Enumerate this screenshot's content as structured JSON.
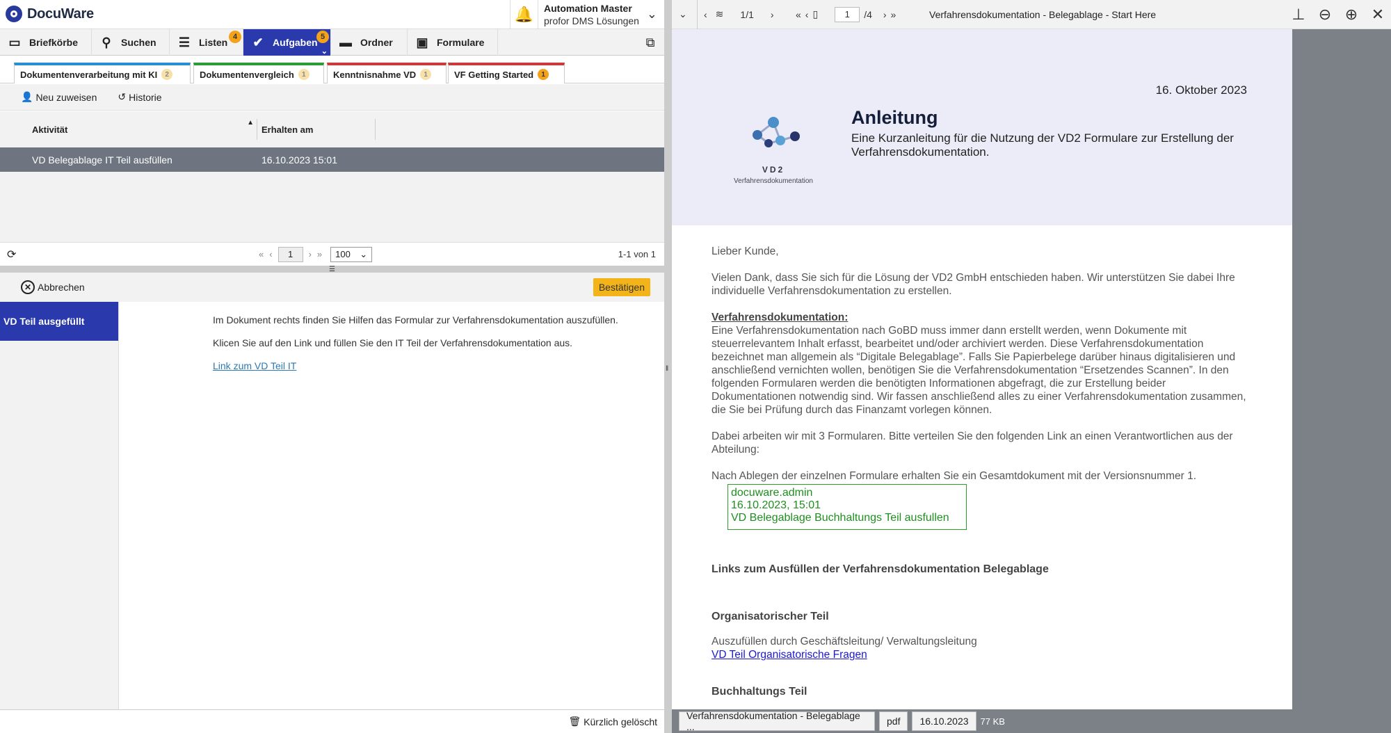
{
  "app": {
    "name": "DocuWare",
    "user_name": "Automation Master",
    "user_company": "profor DMS Lösungen"
  },
  "nav": {
    "items": [
      {
        "label": "Briefkörbe",
        "icon": "inbox-icon"
      },
      {
        "label": "Suchen",
        "icon": "search-icon"
      },
      {
        "label": "Listen",
        "icon": "list-icon",
        "badge": "4"
      },
      {
        "label": "Aufgaben",
        "icon": "check-icon",
        "badge": "5",
        "active": true
      },
      {
        "label": "Ordner",
        "icon": "folder-icon"
      },
      {
        "label": "Formulare",
        "icon": "clipboard-icon"
      }
    ]
  },
  "tabs": [
    {
      "label": "Dokumentenverarbeitung mit KI",
      "badge": "2",
      "color": "#2a8fd0"
    },
    {
      "label": "Dokumentenvergleich",
      "badge": "1",
      "color": "#2a9a3a"
    },
    {
      "label": "Kenntnisnahme VD",
      "badge": "1",
      "color": "#c93a3a"
    },
    {
      "label": "VF Getting Started",
      "badge": "1",
      "color": "#c93a3a"
    }
  ],
  "actions": {
    "reassign": "Neu zuweisen",
    "history": "Historie"
  },
  "grid": {
    "columns": [
      "Aktivität",
      "Erhalten am"
    ],
    "rows": [
      {
        "activity": "VD Belegablage IT Teil ausfüllen",
        "received": "16.10.2023 15:01"
      }
    ]
  },
  "pager": {
    "page": "1",
    "page_size": "100",
    "count": "1-1 von 1"
  },
  "form": {
    "cancel": "Abbrechen",
    "confirm": "Bestätigen",
    "step": "VD Teil ausgefüllt",
    "text1": "Im Dokument rechts finden Sie Hilfen das Formular zur Verfahrensdokumentation auszufüllen.",
    "text2": "Klicen Sie auf den Link und füllen Sie den IT Teil der Verfahrensdokumentation aus.",
    "link": "Link zum VD Teil IT"
  },
  "footer": {
    "recent": "Kürzlich gelöscht"
  },
  "viewer": {
    "stack_count": "1/1",
    "page": "1",
    "page_total": "/4",
    "title": "Verfahrensdokumentation - Belegablage - Start Here",
    "doc": {
      "date": "16. Oktober 2023",
      "heading": "Anleitung",
      "subheading": "Eine Kurzanleitung für die Nutzung der VD2 Formulare zur Erstellung der Verfahrensdokumentation.",
      "logo_title": "VD2",
      "logo_sub": "Verfahrensdokumentation",
      "greeting": "Lieber Kunde,",
      "p1": "Vielen Dank, dass Sie sich für die Lösung der VD2 GmbH entschieden haben. Wir unterstützen Sie dabei Ihre individuelle Verfahrensdokumentation zu erstellen.",
      "vd_heading": "Verfahrensdokumentation:",
      "p2": "Eine Verfahrensdokumentation nach GoBD muss immer dann erstellt werden, wenn Dokumente mit steuerrelevantem Inhalt erfasst, bearbeitet und/oder archiviert werden. Diese Verfahrensdokumentation bezeichnet man allgemein als “Digitale Belegablage”. Falls Sie Papierbelege darüber hinaus digitalisieren und anschließend vernichten wollen, benötigen Sie die Verfahrensdokumentation “Ersetzendes Scannen”. In den folgenden Formularen werden die benötigten Informationen abgefragt, die zur Erstellung beider Dokumentationen notwendig sind. Wir fassen anschließend alles zu einer Verfahrensdokumentation zusammen, die Sie bei Prüfung durch das Finanzamt vorlegen können.",
      "p3": "Dabei arbeiten wir mit 3 Formularen. Bitte verteilen Sie den folgenden Link an einen Verantwortlichen aus der Abteilung:",
      "p4": "Nach Ablegen der einzelnen Formulare erhalten Sie ein Gesamtdokument mit der Versionsnummer 1.",
      "stamp_user": "docuware.admin",
      "stamp_time": "16.10.2023, 15:01",
      "stamp_text": "VD Belegablage Buchhaltungs Teil ausfullen",
      "links_heading": "Links zum Ausfüllen der Verfahrensdokumentation Belegablage",
      "org_heading": "Organisatorischer Teil",
      "org_text": "Auszufüllen durch Geschäftsleitung/ Verwaltungsleitung",
      "org_link": "VD Teil Organisatorische Fragen",
      "buch_heading": "Buchhaltungs Teil"
    },
    "footer": {
      "name": "Verfahrensdokumentation - Belegablage ...",
      "type": "pdf",
      "date": "16.10.2023",
      "size": "77 KB"
    }
  }
}
